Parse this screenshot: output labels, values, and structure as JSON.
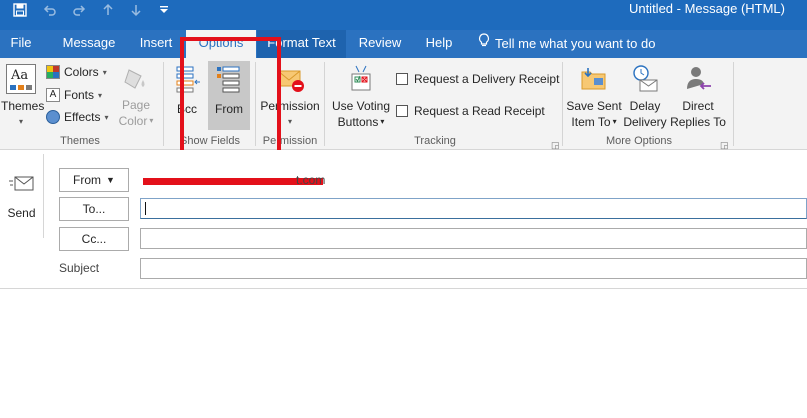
{
  "window": {
    "title": "Untitled  -  Message (HTML)"
  },
  "quick_access": [
    "save-icon",
    "undo-icon",
    "redo-icon",
    "up-arrow-icon",
    "down-arrow-icon",
    "customize-icon"
  ],
  "tabs": [
    {
      "label": "File",
      "active": false
    },
    {
      "label": "Message",
      "active": false
    },
    {
      "label": "Insert",
      "active": false
    },
    {
      "label": "Options",
      "active": true
    },
    {
      "label": "Format Text",
      "active": false
    },
    {
      "label": "Review",
      "active": false
    },
    {
      "label": "Help",
      "active": false
    }
  ],
  "tell_me": {
    "text": "Tell me what you want to do",
    "icon": "lightbulb-icon"
  },
  "ribbon": {
    "themes": {
      "group_label": "Themes",
      "themes_button": "Themes",
      "colors": "Colors",
      "fonts": "Fonts",
      "effects": "Effects",
      "page_color_line1": "Page",
      "page_color_line2": "Color"
    },
    "show_fields": {
      "group_label": "Show Fields",
      "bcc": "Bcc",
      "from": "From"
    },
    "permission": {
      "group_label": "Permission",
      "button": "Permission"
    },
    "tracking": {
      "group_label": "Tracking",
      "voting_line1": "Use Voting",
      "voting_line2": "Buttons",
      "delivery_receipt": "Request a Delivery Receipt",
      "read_receipt": "Request a Read Receipt"
    },
    "more_options": {
      "group_label": "More Options",
      "save_sent_line1": "Save Sent",
      "save_sent_line2": "Item To",
      "delay_line1": "Delay",
      "delay_line2": "Delivery",
      "direct_line1": "Direct",
      "direct_line2": "Replies To"
    }
  },
  "compose": {
    "send": "Send",
    "from_button": "From",
    "from_value_visible_suffix": "t.com",
    "to_button": "To...",
    "cc_button": "Cc...",
    "subject_label": "Subject",
    "to_value": "",
    "cc_value": "",
    "subject_value": ""
  },
  "colors": {
    "titlebar": "#1e6bbd",
    "tabbar": "#2b72c0",
    "ribbon": "#f3f3f3",
    "annotation": "#e3101a"
  }
}
